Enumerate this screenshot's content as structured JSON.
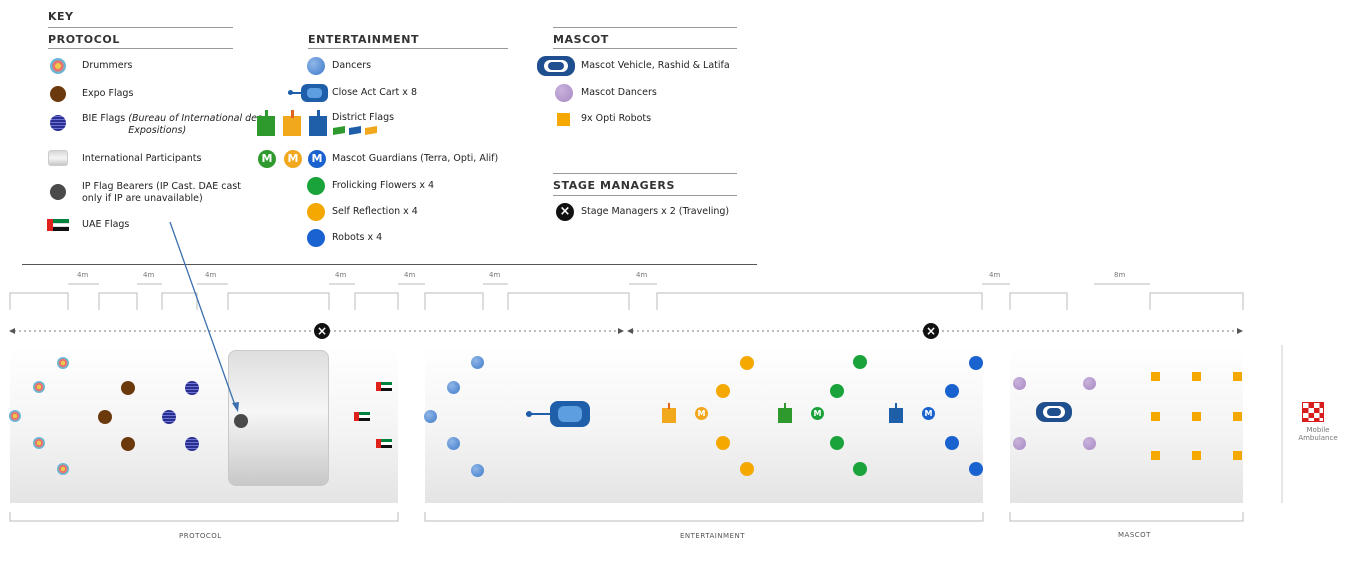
{
  "key": {
    "title": "KEY",
    "protocol": {
      "title": "PROTOCOL",
      "items": [
        {
          "label": "Drummers",
          "icon": "drummer-icon"
        },
        {
          "label": "Expo Flags",
          "icon": "expo-flag-icon"
        },
        {
          "label": "BIE Flags",
          "label_italic": "(Bureau of International des Expositions)",
          "icon": "bie-flag-icon"
        },
        {
          "label": "International Participants",
          "icon": "participants-box-icon"
        },
        {
          "label": "IP Flag Bearers (IP Cast. DAE cast only if IP are unavailable)",
          "icon": "flag-bearer-icon"
        },
        {
          "label": "UAE Flags",
          "icon": "uae-flag-icon"
        }
      ]
    },
    "entertainment": {
      "title": "ENTERTAINMENT",
      "items": [
        {
          "label": "Dancers",
          "icon": "dancer-icon"
        },
        {
          "label": "Close Act Cart x 8",
          "icon": "cart-icon"
        },
        {
          "label": "District Flags",
          "icon": "district-flags-icon"
        },
        {
          "label": "Mascot Guardians (Terra, Opti, Alif)",
          "icon": "guardian-icon"
        },
        {
          "label": "Frolicking Flowers x 4",
          "icon": "green-dot-icon"
        },
        {
          "label": "Self Reflection x 4",
          "icon": "orange-dot-icon"
        },
        {
          "label": "Robots x 4",
          "icon": "blue-dot-icon"
        }
      ]
    },
    "mascot": {
      "title": "MASCOT",
      "items": [
        {
          "label": "Mascot Vehicle, Rashid & Latifa",
          "icon": "mascot-vehicle-icon"
        },
        {
          "label": "Mascot Dancers",
          "icon": "purple-dot-icon"
        },
        {
          "label": "9x Opti Robots",
          "icon": "opti-robot-icon"
        }
      ]
    },
    "stage_managers": {
      "title": "STAGE MANAGERS",
      "items": [
        {
          "label": "Stage Managers x 2 (Traveling)",
          "icon": "stage-manager-icon"
        }
      ]
    }
  },
  "spacings": [
    "4m",
    "4m",
    "4m",
    "4m",
    "4m",
    "4m",
    "4m",
    "4m",
    "8m"
  ],
  "sections": {
    "protocol": "PROTOCOL",
    "entertainment": "ENTERTAINMENT",
    "mascot": "MASCOT"
  },
  "guardian_letter": "M",
  "ambulance": {
    "label_line1": "Mobile",
    "label_line2": "Ambulance"
  },
  "colors": {
    "expo_flag": "#6b3a0c",
    "bie_flag": "#2a2f8f",
    "flag_bearer": "#4a4a4a",
    "dancer": "#3f7bc9",
    "cart": "#1f5ea8",
    "flower": "#1aa33a",
    "reflection": "#f5a800",
    "robot": "#1a62cf",
    "mascot_dancer": "#a789c2",
    "opti_robot": "#f5a800",
    "arrow": "#3b6fb0"
  }
}
